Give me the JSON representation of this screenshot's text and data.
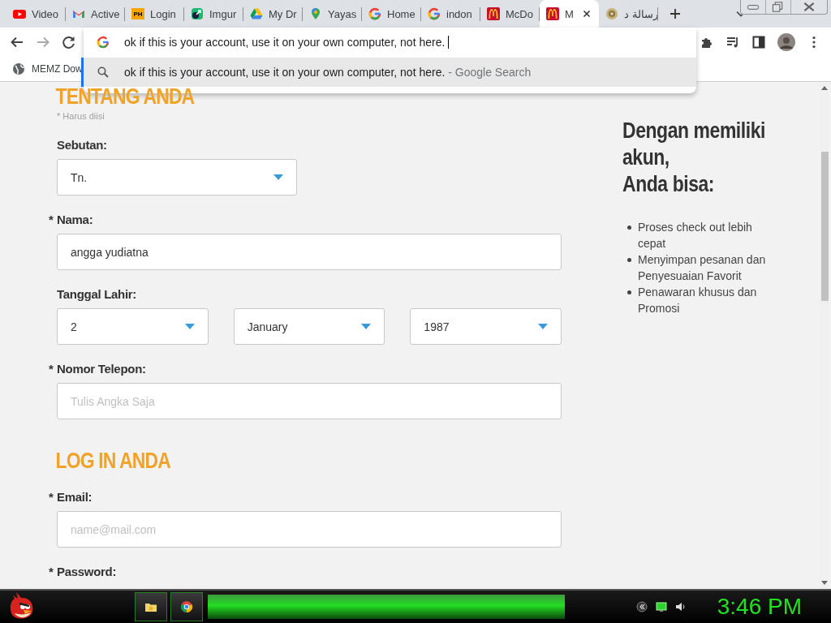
{
  "browser": {
    "tabs": [
      {
        "kind": "youtube",
        "title": "Video",
        "selected": false
      },
      {
        "kind": "gmail",
        "title": "Active",
        "selected": false
      },
      {
        "kind": "badge",
        "badge": "PH",
        "title": "Login",
        "selected": false
      },
      {
        "kind": "imgur",
        "title": "Imgur",
        "selected": false
      },
      {
        "kind": "drive",
        "title": "My Dr",
        "selected": false
      },
      {
        "kind": "maps",
        "title": "Yayas",
        "selected": false
      },
      {
        "kind": "google",
        "title": "Home",
        "selected": false
      },
      {
        "kind": "google",
        "title": "indon",
        "selected": false
      },
      {
        "kind": "mcd",
        "title": "McDo",
        "selected": false
      },
      {
        "kind": "mcd",
        "title": "M",
        "selected": true
      },
      {
        "kind": "emblem",
        "title": "رسالة د",
        "selected": false
      }
    ],
    "omnibox": {
      "value": "ok if this is your account, use it on your own computer, not here.",
      "suggestion": "ok if this is your account, use it on your own computer, not here.",
      "suggestion_source": "- Google Search"
    },
    "bookmarks": [
      {
        "title": "MEMZ Dow"
      }
    ]
  },
  "page": {
    "sections": [
      {
        "heading": "TENTANG ANDA",
        "note": "* Harus diisi",
        "fields": [
          {
            "kind": "select",
            "label": "Sebutan:",
            "value": "Tn."
          },
          {
            "kind": "text",
            "marker": "*",
            "label": "Nama:",
            "value": "angga yudiatna"
          },
          {
            "kind": "date",
            "label": "Tanggal Lahir:",
            "parts": [
              "2",
              "January",
              "1987"
            ]
          },
          {
            "kind": "text",
            "marker": "*",
            "label": "Nomor Telepon:",
            "placeholder": "Tulis Angka Saja"
          }
        ]
      },
      {
        "heading": "LOG IN ANDA",
        "fields": [
          {
            "kind": "text",
            "marker": "*",
            "label": "Email:",
            "placeholder": "name@mail.com"
          },
          {
            "kind": "label",
            "marker": "*",
            "label": "Password:"
          }
        ]
      }
    ],
    "sidebar": {
      "title_lines": [
        "Dengan memiliki akun,",
        "Anda bisa:"
      ],
      "items": [
        "Proses check out lebih cepat",
        "Menyimpan pesanan dan Penyesuaian Favorit",
        "Penawaran khusus dan Promosi"
      ]
    }
  },
  "taskbar": {
    "clock": "3:46 PM"
  }
}
